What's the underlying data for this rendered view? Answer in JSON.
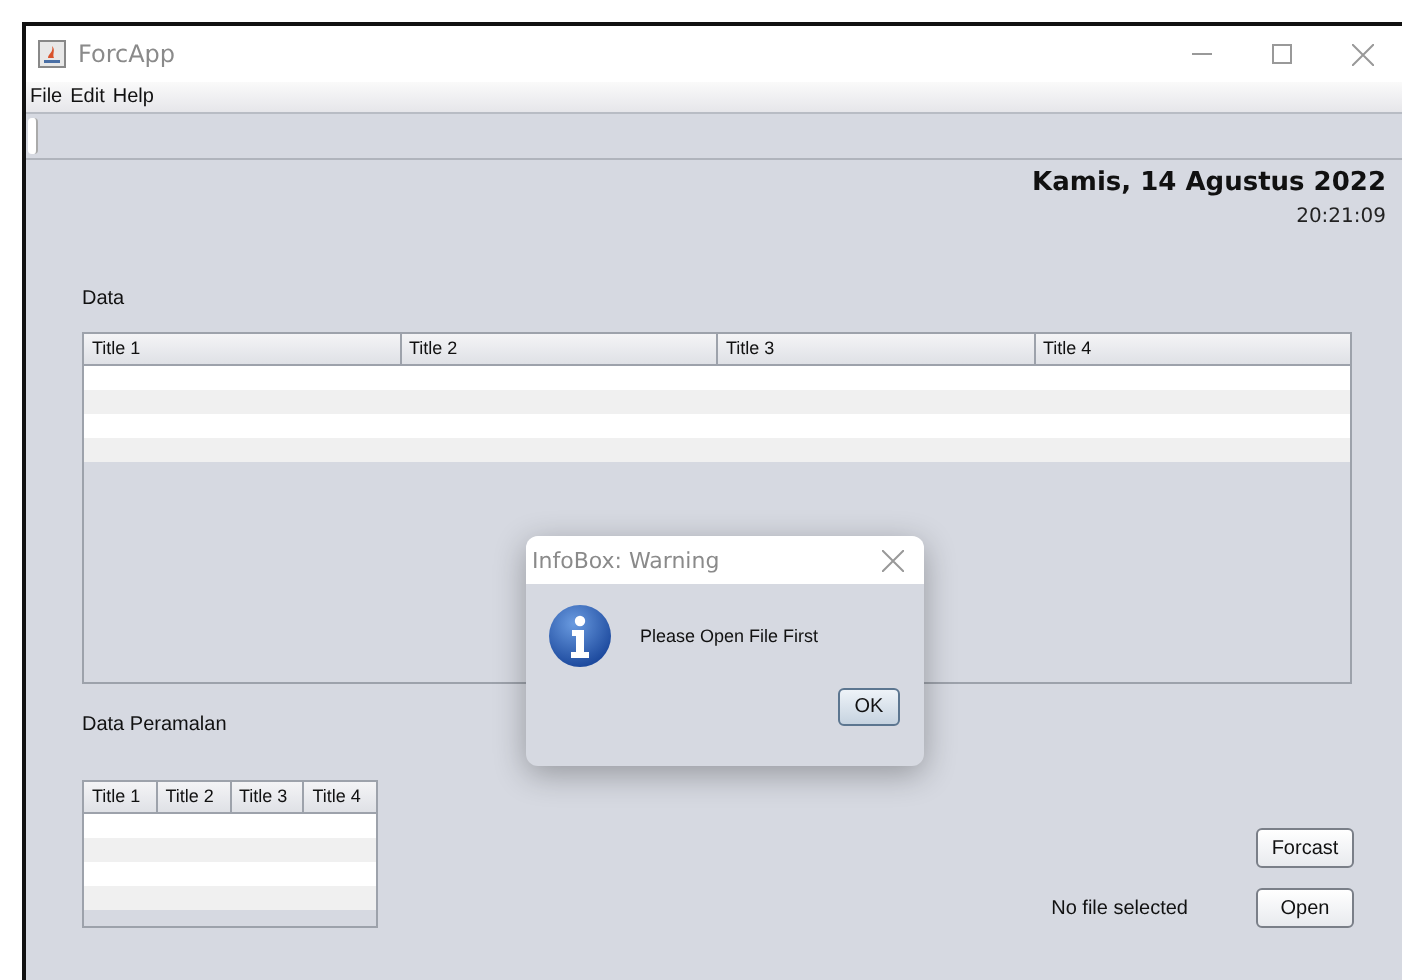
{
  "window": {
    "title": "ForcApp"
  },
  "menu": [
    "File",
    "Edit",
    "Help"
  ],
  "date": "Kamis, 14 Agustus 2022",
  "time": "20:21:09",
  "data_section": {
    "label": "Data",
    "columns": [
      "Title 1",
      "Title 2",
      "Title 3",
      "Title 4"
    ]
  },
  "forecast_section": {
    "label": "Data Peramalan",
    "columns": [
      "Title 1",
      "Title 2",
      "Title 3",
      "Title 4"
    ]
  },
  "file_status": "No file selected",
  "buttons": [
    "Forcast",
    "Open"
  ],
  "dialog": {
    "title": "InfoBox: Warning",
    "kind": "info",
    "message": "Please Open File First",
    "button": "OK"
  }
}
